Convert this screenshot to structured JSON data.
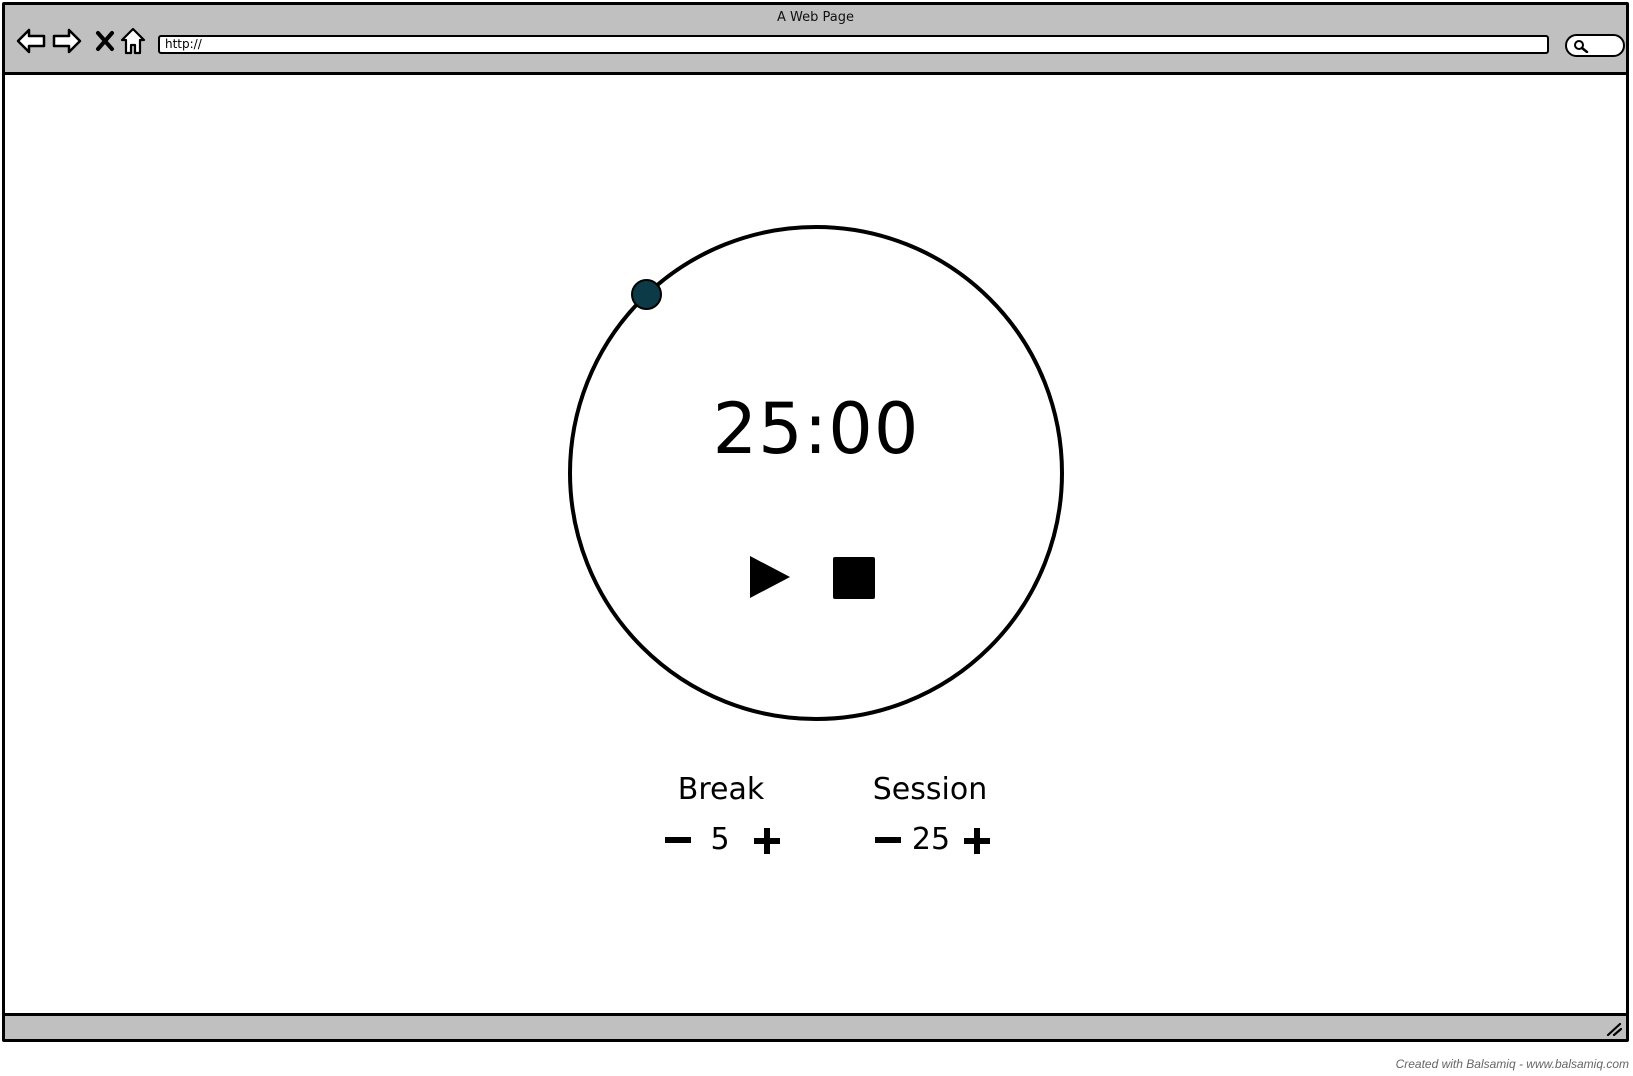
{
  "browser": {
    "window_title": "A Web Page",
    "address": "http://"
  },
  "timer": {
    "time": "25:00",
    "progress": 0.0
  },
  "settings": {
    "break": {
      "label": "Break",
      "value": "5"
    },
    "session": {
      "label": "Session",
      "value": "25"
    }
  },
  "footer": {
    "credit": "Created with Balsamiq - www.balsamiq.com"
  },
  "colors": {
    "chrome": "#c0c0c0",
    "knob": "#0d3a47"
  },
  "icons": {
    "back": "back-arrow-icon",
    "forward": "forward-arrow-icon",
    "stop": "close-icon",
    "home": "home-icon",
    "search": "search-icon",
    "play": "play-icon",
    "stop_timer": "stop-icon",
    "minus": "minus-icon",
    "plus": "plus-icon",
    "resize": "resize-grip-icon"
  }
}
